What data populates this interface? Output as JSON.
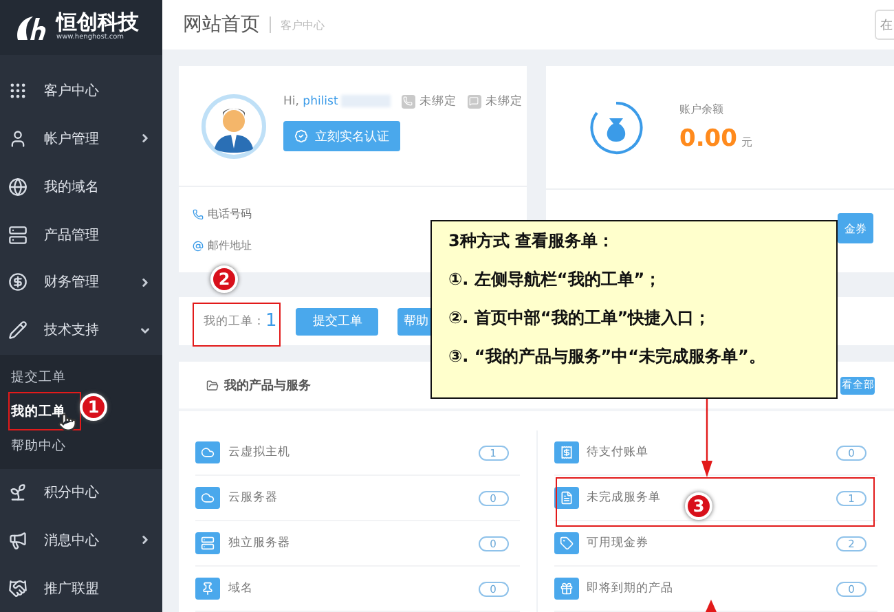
{
  "sidebar": {
    "logo": {
      "name": "恒创科技",
      "url": "www.henghost.com"
    },
    "items": [
      {
        "label": "客户中心"
      },
      {
        "label": "帐户管理",
        "expanded": false
      },
      {
        "label": "我的域名"
      },
      {
        "label": "产品管理"
      },
      {
        "label": "财务管理",
        "expanded": false
      },
      {
        "label": "技术支持",
        "expanded": true,
        "children": [
          {
            "label": "提交工单",
            "selected": false
          },
          {
            "label": "我的工单",
            "selected": true
          },
          {
            "label": "帮助中心",
            "selected": false
          }
        ]
      },
      {
        "label": "积分中心"
      },
      {
        "label": "消息中心",
        "expanded": false
      },
      {
        "label": "推广联盟"
      }
    ]
  },
  "header": {
    "title": "网站首页",
    "subtitle": "客户中心",
    "search_visible": "在"
  },
  "user_card": {
    "greeting": "Hi,",
    "username": "philist",
    "phone_status": "未绑定",
    "wechat_status": "未绑定",
    "verify_button": "立刻实名认证",
    "phone_label": "电话号码",
    "email_label": "邮件地址"
  },
  "balance_card": {
    "label": "账户余额",
    "amount": "0.00",
    "unit": "元",
    "button_visible": "金券"
  },
  "ticket_bar": {
    "label": "我的工单：",
    "count": "1",
    "submit_button": "提交工单",
    "help_button_visible": "帮助"
  },
  "products": {
    "title": "我的产品与服务",
    "view_all_visible": "看全部",
    "left": [
      {
        "label": "云虚拟主机",
        "count": "1"
      },
      {
        "label": "云服务器",
        "count": "0"
      },
      {
        "label": "独立服务器",
        "count": "0"
      },
      {
        "label": "域名",
        "count": "0"
      }
    ],
    "right": [
      {
        "label": "待支付账单",
        "count": "0"
      },
      {
        "label": "未完成服务单",
        "count": "1"
      },
      {
        "label": "可用现金券",
        "count": "2"
      },
      {
        "label": "即将到期的产品",
        "count": "0"
      }
    ]
  },
  "annotation": {
    "title": "3种方式 查看服务单：",
    "lines": [
      "①. 左侧导航栏“我的工单”；",
      "②. 首页中部“我的工单”快捷入口；",
      "③. “我的产品与服务”中“未完成服务单”。"
    ],
    "markers": [
      "1",
      "2",
      "3"
    ]
  }
}
